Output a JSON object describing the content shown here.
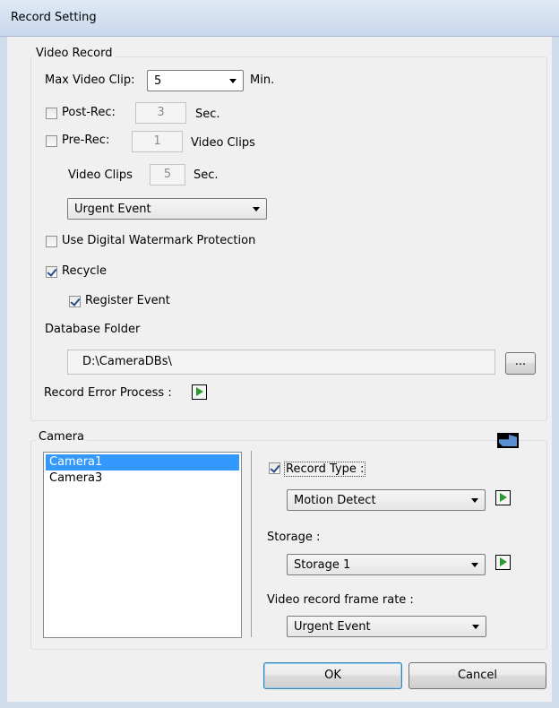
{
  "window": {
    "title": "Record Setting"
  },
  "video_record": {
    "group_label": "Video Record",
    "max_clip_label": "Max Video Clip:",
    "max_clip_value": "5",
    "max_clip_unit": "Min.",
    "post_rec_label": "Post-Rec:",
    "post_rec_checked": false,
    "post_rec_value": "3",
    "post_rec_unit": "Sec.",
    "pre_rec_label": "Pre-Rec:",
    "pre_rec_checked": false,
    "pre_rec_value": "1",
    "pre_rec_unit": "Video Clips",
    "video_clips_label": "Video Clips",
    "video_clips_value": "5",
    "video_clips_unit": "Sec.",
    "event_combo_value": "Urgent Event",
    "watermark_label": "Use Digital Watermark Protection",
    "watermark_checked": false,
    "recycle_label": "Recycle",
    "recycle_checked": true,
    "register_event_label": "Register Event",
    "register_event_checked": true,
    "db_folder_label": "Database Folder",
    "db_folder_value": "D:\\CameraDBs\\",
    "browse_label": "...",
    "error_process_label": "Record Error Process :"
  },
  "camera": {
    "group_label": "Camera",
    "cameras": [
      "Camera1",
      "Camera3"
    ],
    "selected_camera": "Camera1",
    "record_type_label": "Record Type :",
    "record_type_checked": true,
    "record_type_value": "Motion Detect",
    "storage_label": "Storage :",
    "storage_value": "Storage 1",
    "frame_rate_label": "Video record frame rate :",
    "frame_rate_value": "Urgent Event"
  },
  "buttons": {
    "ok": "OK",
    "cancel": "Cancel"
  },
  "colors": {
    "selection": "#3399ff",
    "play_icon": "#2a9a2a",
    "title_bar": "#dfe9f5"
  },
  "icons": {
    "play": "play-icon",
    "hand": "hand-pointer-icon",
    "dropdown": "chevron-down-icon"
  }
}
